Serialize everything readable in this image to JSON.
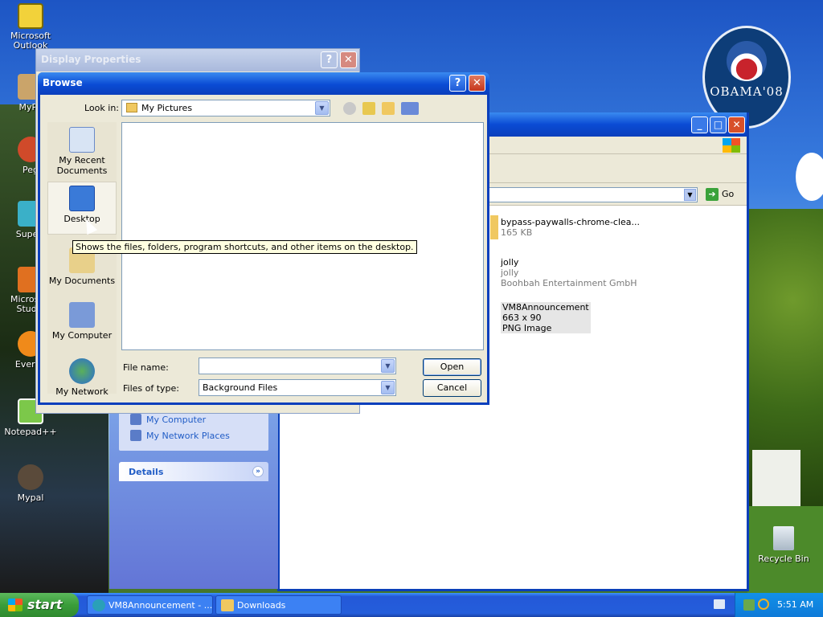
{
  "desktop": {
    "icons": [
      {
        "label": "Microsoft\nOutlook"
      },
      {
        "label": "MyPa"
      },
      {
        "label": "Peg"
      },
      {
        "label": "Superr"
      },
      {
        "label": "Microsoft\nStudio"
      },
      {
        "label": "Everyb"
      },
      {
        "label": "Notepad++"
      },
      {
        "label": "Mypal"
      }
    ],
    "recycle_bin": "Recycle Bin",
    "wallpaper_badge": "OBAMA'08"
  },
  "explorer": {
    "go_label": "Go",
    "files": [
      {
        "name": "bypass-paywalls-chrome-clea...",
        "line2": "165 KB",
        "line3": ""
      },
      {
        "name": "jolly",
        "line2": "jolly",
        "line3": "Boohbah Entertainment GmbH"
      },
      {
        "name": "VM8Announcement",
        "line2": "663 x 90",
        "line3": "PNG Image"
      }
    ],
    "task_links": [
      "My Computer",
      "My Network Places"
    ],
    "details_header": "Details"
  },
  "display_properties": {
    "title": "Display Properties",
    "help": "?",
    "close": "✕"
  },
  "browse": {
    "title": "Browse",
    "help": "?",
    "close": "✕",
    "look_in_label": "Look in:",
    "look_in_value": "My Pictures",
    "places": [
      {
        "label": "My Recent Documents",
        "icon": "recent-documents-icon"
      },
      {
        "label": "Desktop",
        "icon": "desktop-icon"
      },
      {
        "label": "My Documents",
        "icon": "my-documents-icon"
      },
      {
        "label": "My Computer",
        "icon": "my-computer-icon"
      },
      {
        "label": "My Network",
        "icon": "my-network-icon"
      }
    ],
    "file_name_label": "File name:",
    "file_name_value": "",
    "file_type_label": "Files of type:",
    "file_type_value": "Background Files",
    "open_label": "Open",
    "cancel_label": "Cancel",
    "tooltip": "Shows the files, folders, program shortcuts, and other items on the desktop."
  },
  "taskbar": {
    "start": "start",
    "tasks": [
      {
        "label": "VM8Announcement - ..."
      },
      {
        "label": "Downloads"
      }
    ],
    "clock": "5:51 AM"
  }
}
